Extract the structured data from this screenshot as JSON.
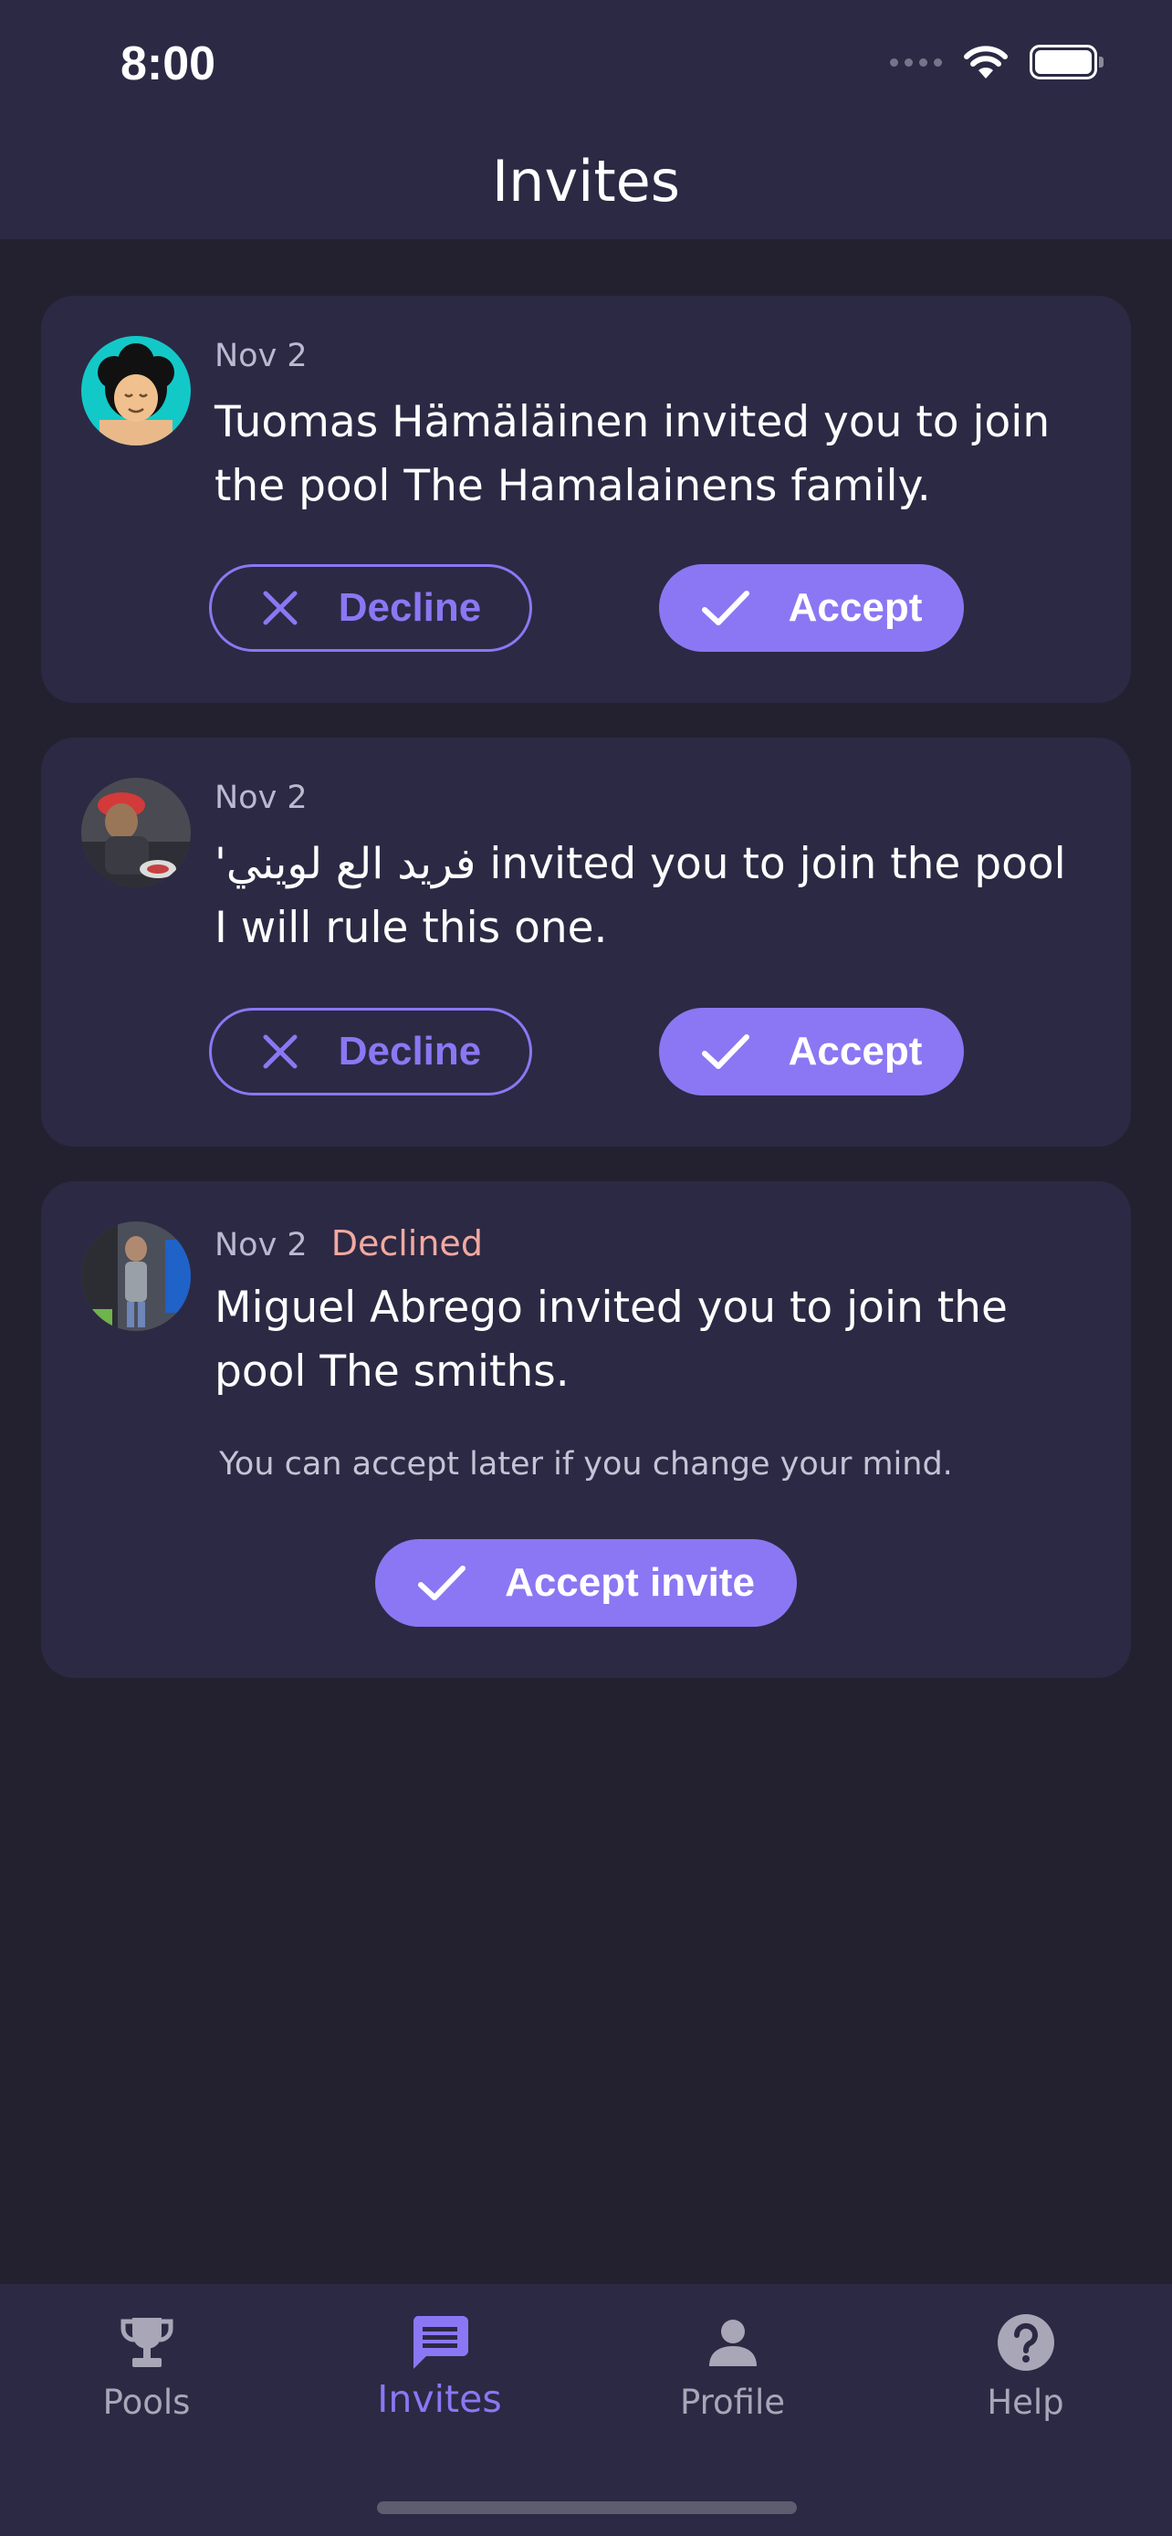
{
  "status_bar": {
    "time": "8:00"
  },
  "header": {
    "title": "Invites"
  },
  "invites": [
    {
      "date": "Nov 2",
      "message": "Tuomas Hämäläinen invited you to join the pool The Hamalainens family.",
      "decline_label": "Decline",
      "accept_label": "Accept"
    },
    {
      "date": "Nov 2",
      "message": "'فريد الع لويني invited you to join the pool I will rule this one.",
      "decline_label": "Decline",
      "accept_label": "Accept"
    },
    {
      "date": "Nov 2",
      "status": "Declined",
      "message": "Miguel Abrego invited you to join the pool The smiths.",
      "note": "You can accept later if you change your mind.",
      "accept_label": "Accept invite"
    }
  ],
  "tabs": [
    {
      "label": "Pools",
      "icon": "trophy-icon"
    },
    {
      "label": "Invites",
      "icon": "chat-icon",
      "active": true
    },
    {
      "label": "Profile",
      "icon": "person-icon"
    },
    {
      "label": "Help",
      "icon": "help-icon"
    }
  ],
  "colors": {
    "background": "#23212f",
    "surface": "#2c2944",
    "accent": "#8b77f3",
    "declined": "#f3a9a0"
  }
}
